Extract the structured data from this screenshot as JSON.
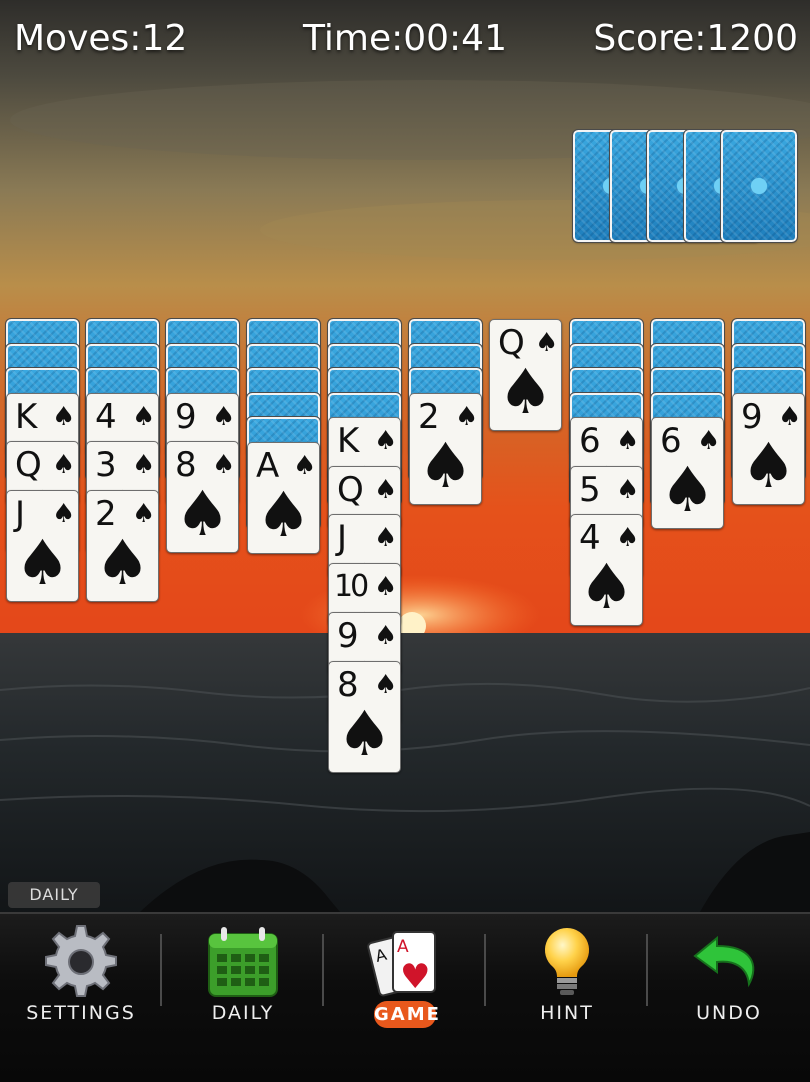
{
  "hud": {
    "moves_label": "Moves:",
    "moves_value": "12",
    "time_label": "Time:",
    "time_value": "00:41",
    "score_label": "Score:",
    "score_value": "1200"
  },
  "stock": {
    "deals_remaining": 5
  },
  "tableau": [
    {
      "face_down": 3,
      "face_up": [
        {
          "rank": "K",
          "suit": "♠"
        },
        {
          "rank": "Q",
          "suit": "♠"
        },
        {
          "rank": "J",
          "suit": "♠"
        }
      ]
    },
    {
      "face_down": 3,
      "face_up": [
        {
          "rank": "4",
          "suit": "♠"
        },
        {
          "rank": "3",
          "suit": "♠"
        },
        {
          "rank": "2",
          "suit": "♠"
        }
      ]
    },
    {
      "face_down": 3,
      "face_up": [
        {
          "rank": "9",
          "suit": "♠"
        },
        {
          "rank": "8",
          "suit": "♠"
        }
      ]
    },
    {
      "face_down": 5,
      "face_up": [
        {
          "rank": "A",
          "suit": "♠"
        }
      ]
    },
    {
      "face_down": 4,
      "face_up": [
        {
          "rank": "K",
          "suit": "♠"
        },
        {
          "rank": "Q",
          "suit": "♠"
        },
        {
          "rank": "J",
          "suit": "♠"
        },
        {
          "rank": "10",
          "suit": "♠"
        },
        {
          "rank": "9",
          "suit": "♠"
        },
        {
          "rank": "8",
          "suit": "♠"
        }
      ]
    },
    {
      "face_down": 3,
      "face_up": [
        {
          "rank": "2",
          "suit": "♠"
        }
      ]
    },
    {
      "face_down": 0,
      "face_up": [
        {
          "rank": "Q",
          "suit": "♠"
        }
      ]
    },
    {
      "face_down": 4,
      "face_up": [
        {
          "rank": "6",
          "suit": "♠"
        },
        {
          "rank": "5",
          "suit": "♠"
        },
        {
          "rank": "4",
          "suit": "♠"
        }
      ]
    },
    {
      "face_down": 4,
      "face_up": [
        {
          "rank": "6",
          "suit": "♠"
        }
      ]
    },
    {
      "face_down": 3,
      "face_up": [
        {
          "rank": "9",
          "suit": "♠"
        }
      ]
    }
  ],
  "daily_tag": "DAILY",
  "toolbar": {
    "settings_label": "SETTINGS",
    "daily_label": "DAILY",
    "game_label": "GAME",
    "hint_label": "HINT",
    "undo_label": "UNDO",
    "icons": [
      "gear-icon",
      "calendar-icon",
      "cards-icon",
      "lightbulb-icon",
      "undo-arrow-icon"
    ],
    "active_tab": "GAME",
    "accent_color": "#e8581c",
    "calendar_color": "#3c9e2a",
    "undo_color": "#2fc43a"
  },
  "colors": {
    "card_back": "#2a93d2",
    "card_face": "#f7f6f2"
  }
}
